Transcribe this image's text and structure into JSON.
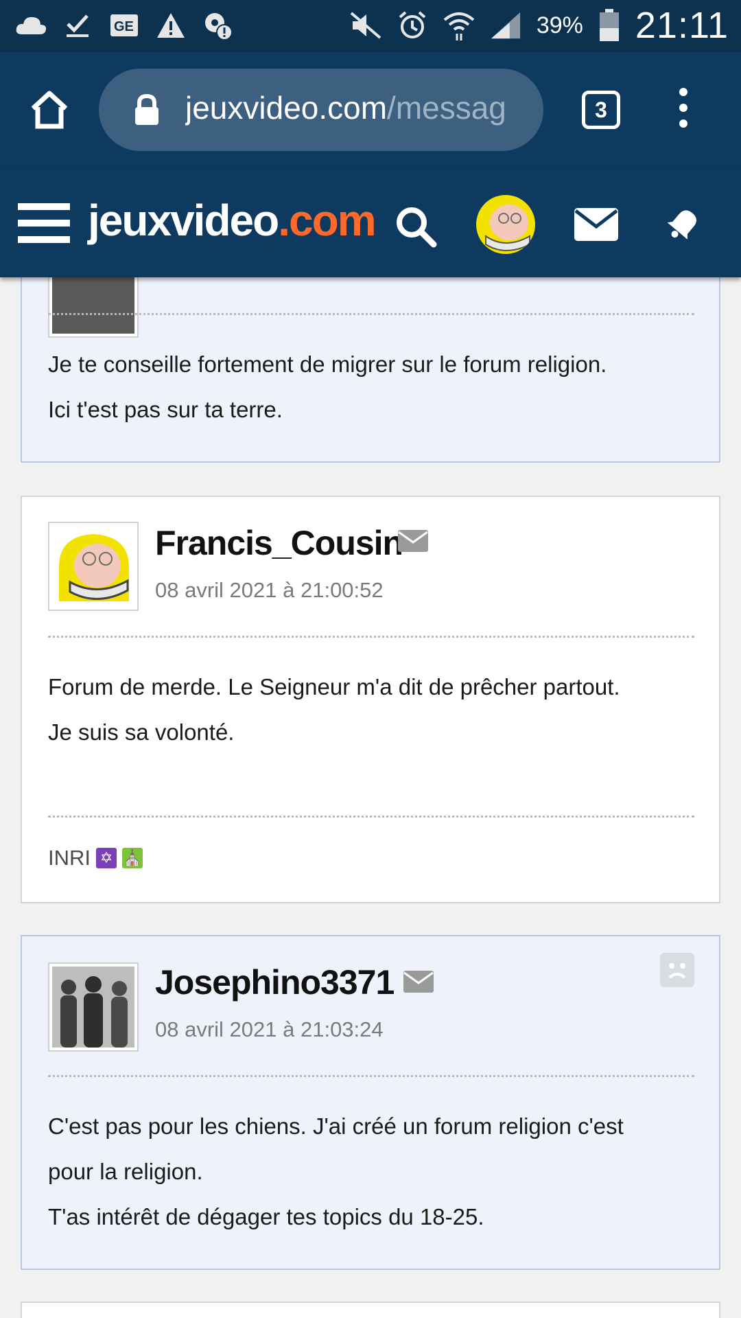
{
  "status_bar": {
    "battery_percent": "39%",
    "time": "21:11",
    "icons_left": [
      "cloud-icon",
      "check-icon",
      "ge-news-icon",
      "warning-icon",
      "settings-alert-icon"
    ],
    "icons_right": [
      "mute-icon",
      "alarm-icon",
      "wifi-icon",
      "signal-icon",
      "battery-icon"
    ]
  },
  "browser": {
    "url_host": "jeuxvideo.com",
    "url_path": "/messag",
    "tab_count": "3"
  },
  "site_header": {
    "logo_main": "jeuxvideo",
    "logo_accent": ".com",
    "accent_color": "#ff6a2c"
  },
  "posts": [
    {
      "author": "",
      "date": "",
      "message_lines": [
        "Je te conseille fortement de migrer sur le forum religion.",
        "Ici t'est pas sur ta terre."
      ]
    },
    {
      "author": "Francis_Cousin",
      "date": "08 avril 2021 à 21:00:52",
      "message_lines": [
        "Forum de merde. Le Seigneur m'a dit de prêcher partout.",
        "Je suis sa volonté."
      ],
      "signature": "INRI"
    },
    {
      "author": "Josephino3371",
      "date": "08 avril 2021 à 21:03:24",
      "message_lines": [
        "C'est pas pour les chiens. J'ai créé un forum religion c'est",
        "pour la religion.",
        "T'as intérêt de dégager tes topics du 18-25."
      ]
    }
  ]
}
